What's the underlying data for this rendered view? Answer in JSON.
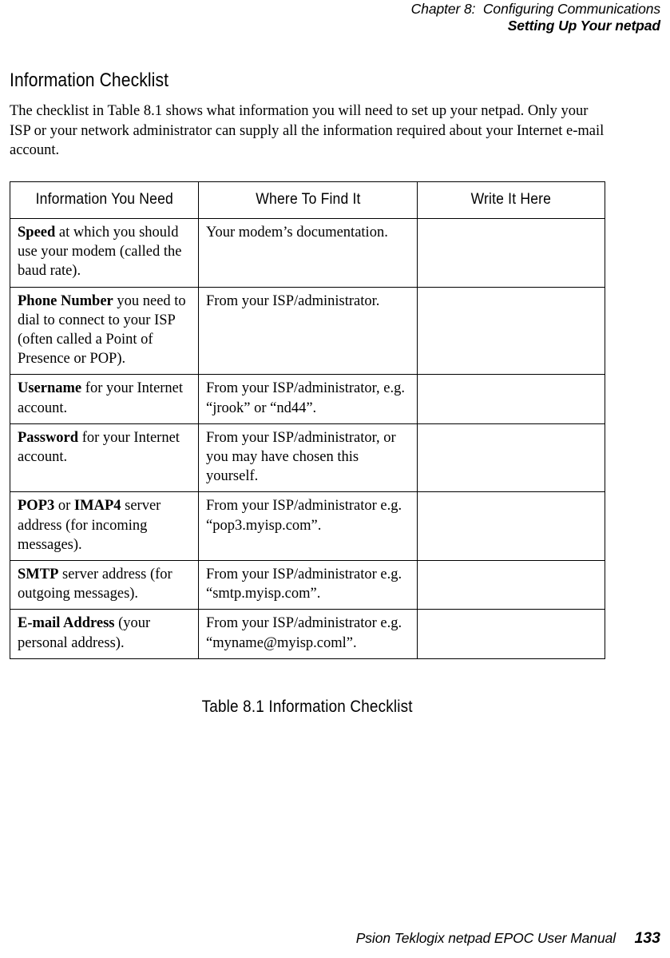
{
  "running_head": {
    "chapter": "Chapter 8:  Configuring Communications",
    "section": "Setting Up Your netpad"
  },
  "section_heading": "Information Checklist",
  "intro_paragraph": "The checklist in Table 8.1 shows what information you will need to set up your netpad. Only your ISP or your network administrator can supply all the information required about your Internet e-mail account.",
  "table": {
    "headers": [
      "Information You Need",
      "Where To Find It",
      "Write It Here"
    ],
    "rows": [
      {
        "info_bold": "Speed",
        "info_rest": " at which you should use your modem (called the baud rate).",
        "where": "Your modem’s documentation.",
        "write": ""
      },
      {
        "info_bold": "Phone Number",
        "info_rest": " you need to dial to connect to your ISP (often called a Point of Presence or POP).",
        "where": "From your ISP/administrator.",
        "write": ""
      },
      {
        "info_bold": "Username",
        "info_rest": " for your Internet account.",
        "where": "From your ISP/administrator, e.g. “jrook” or “nd44”.",
        "write": ""
      },
      {
        "info_bold": "Password",
        "info_rest": " for your Internet account.",
        "where": "From your ISP/administrator, or you may have chosen this yourself.",
        "write": ""
      },
      {
        "info_bold": "POP3",
        "info_mid": " or ",
        "info_bold2": "IMAP4",
        "info_rest": " server address (for incoming messages).",
        "where": "From your ISP/administrator e.g. “pop3.myisp.com”.",
        "write": ""
      },
      {
        "info_bold": "SMTP",
        "info_rest": " server address (for outgoing messages).",
        "where": "From your ISP/administrator e.g. “smtp.myisp.com”.",
        "write": ""
      },
      {
        "info_bold": "E-mail Address",
        "info_rest": " (your personal address).",
        "where": "From your ISP/administrator e.g. “myname@myisp.coml”.",
        "write": ""
      }
    ]
  },
  "table_caption": "Table 8.1 Information Checklist",
  "footer": {
    "manual": "Psion Teklogix netpad EPOC User Manual",
    "page_number": "133"
  }
}
